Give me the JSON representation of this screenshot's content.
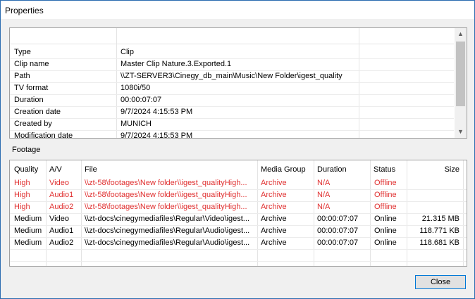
{
  "window": {
    "title": "Properties"
  },
  "properties": [
    {
      "key": "Type",
      "value": "Clip"
    },
    {
      "key": "Clip name",
      "value": "Master Clip Nature.3.Exported.1"
    },
    {
      "key": "Path",
      "value": "\\\\ZT-SERVER3\\Cinegy_db_main\\Music\\New Folder\\igest_quality"
    },
    {
      "key": "TV format",
      "value": "1080i/50"
    },
    {
      "key": "Duration",
      "value": "00:00:07:07"
    },
    {
      "key": "Creation date",
      "value": "9/7/2024 4:15:53 PM"
    },
    {
      "key": "Created by",
      "value": "MUNICH"
    },
    {
      "key": "Modification date",
      "value": "9/7/2024 4:15:53 PM"
    }
  ],
  "footage": {
    "label": "Footage",
    "columns": [
      "Quality",
      "A/V",
      "File",
      "Media Group",
      "Duration",
      "Status",
      "Size"
    ],
    "rows": [
      {
        "quality": "High",
        "av": "Video",
        "file": "\\\\zt-58\\footages\\New folder\\\\igest_qualityHigh...",
        "group": "Archive",
        "duration": "N/A",
        "status": "Offline",
        "size": ""
      },
      {
        "quality": "High",
        "av": "Audio1",
        "file": "\\\\zt-58\\footages\\New folder\\\\igest_qualityHigh...",
        "group": "Archive",
        "duration": "N/A",
        "status": "Offline",
        "size": ""
      },
      {
        "quality": "High",
        "av": "Audio2",
        "file": "\\\\zt-58\\footages\\New folder\\\\igest_qualityHigh...",
        "group": "Archive",
        "duration": "N/A",
        "status": "Offline",
        "size": ""
      },
      {
        "quality": "Medium",
        "av": "Video",
        "file": "\\\\zt-docs\\cinegymediafiles\\Regular\\Video\\igest...",
        "group": "Archive",
        "duration": "00:00:07:07",
        "status": "Online",
        "size": "21.315 MB"
      },
      {
        "quality": "Medium",
        "av": "Audio1",
        "file": "\\\\zt-docs\\cinegymediafiles\\Regular\\Audio\\igest...",
        "group": "Archive",
        "duration": "00:00:07:07",
        "status": "Online",
        "size": "118.771 KB"
      },
      {
        "quality": "Medium",
        "av": "Audio2",
        "file": "\\\\zt-docs\\cinegymediafiles\\Regular\\Audio\\igest...",
        "group": "Archive",
        "duration": "00:00:07:07",
        "status": "Online",
        "size": "118.681 KB"
      }
    ]
  },
  "buttons": {
    "close": "Close"
  },
  "colors": {
    "offline_text": "#e03030",
    "accent": "#0078d7"
  },
  "icons": {
    "scroll_up": "chevron-up-icon",
    "scroll_down": "chevron-down-icon"
  }
}
